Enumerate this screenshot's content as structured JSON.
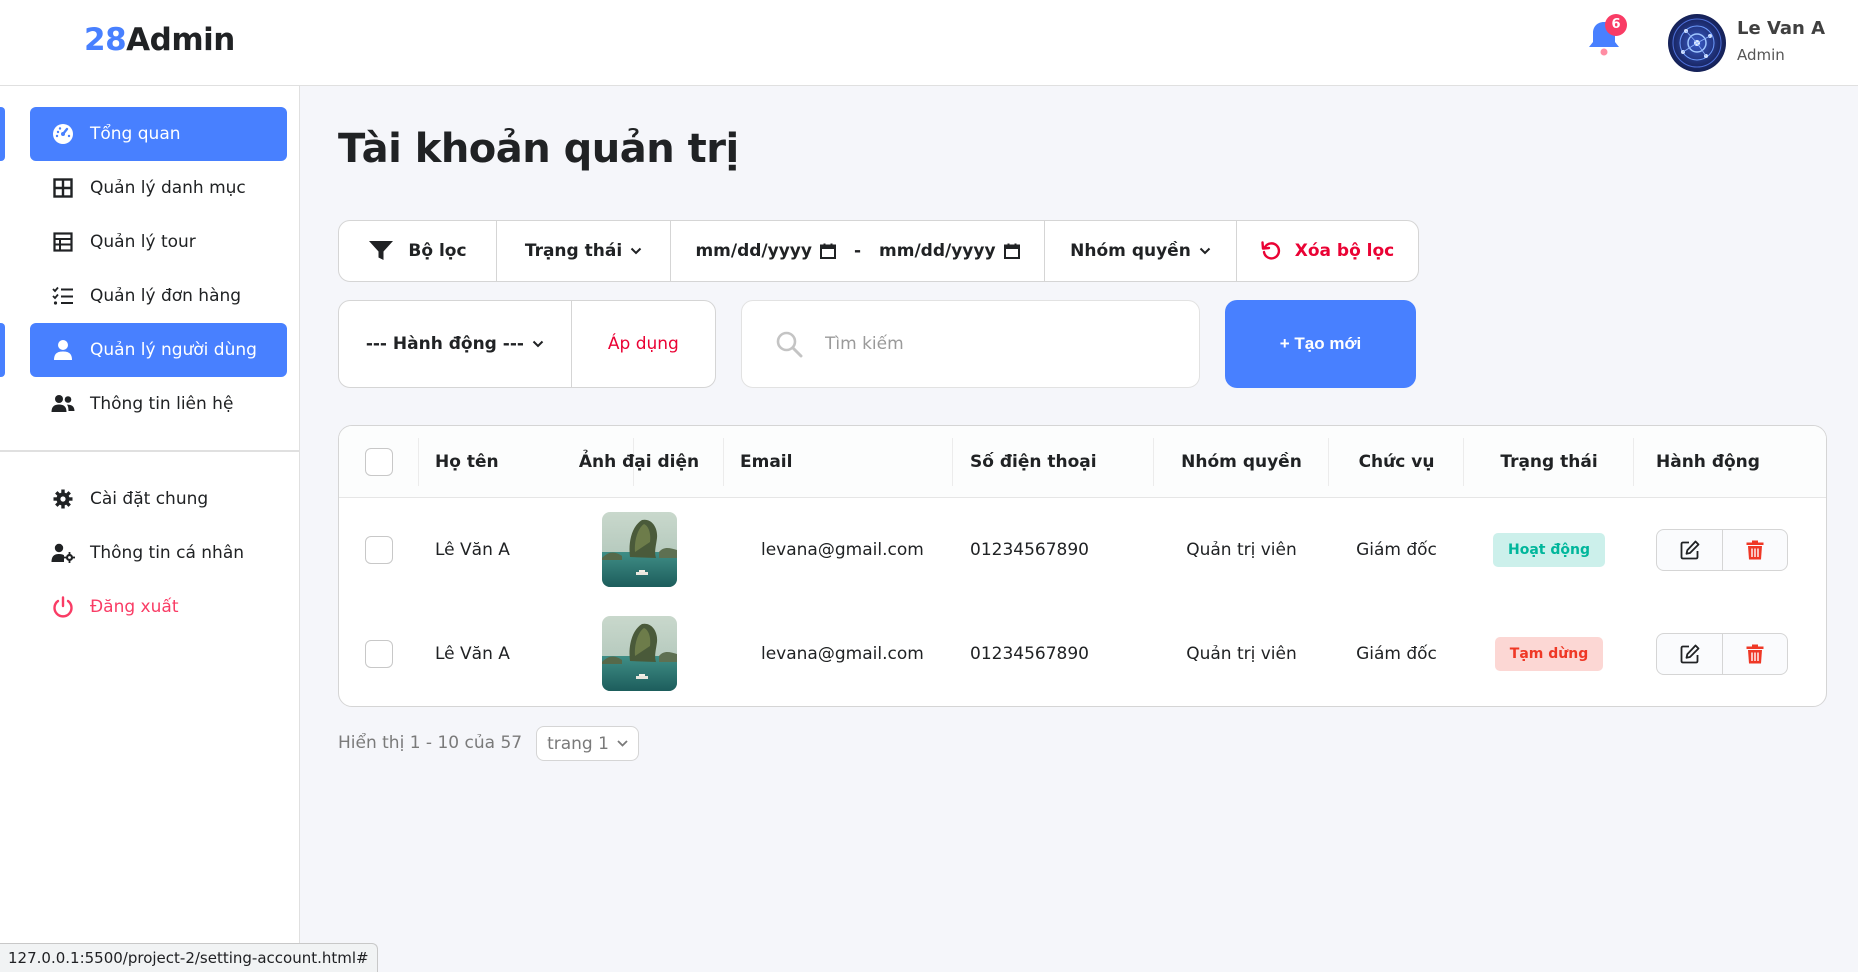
{
  "header": {
    "logo_number": "28",
    "logo_text": "Admin",
    "notification_count": "6",
    "user_name": "Le Van A",
    "user_role": "Admin"
  },
  "sidebar": {
    "items": [
      {
        "label": "Tổng quan",
        "icon": "dashboard-icon",
        "active": true
      },
      {
        "label": "Quản lý danh mục",
        "icon": "grid-icon",
        "active": false
      },
      {
        "label": "Quản lý tour",
        "icon": "table-icon",
        "active": false
      },
      {
        "label": "Quản lý đơn hàng",
        "icon": "checklist-icon",
        "active": false
      },
      {
        "label": "Quản lý người dùng",
        "icon": "user-icon",
        "active": true
      },
      {
        "label": "Thông tin liên hệ",
        "icon": "users-icon",
        "active": false
      }
    ],
    "bottom_items": [
      {
        "label": "Cài đặt chung",
        "icon": "gear-icon"
      },
      {
        "label": "Thông tin cá nhân",
        "icon": "user-gear-icon"
      },
      {
        "label": "Đăng xuất",
        "icon": "power-icon"
      }
    ]
  },
  "main": {
    "title": "Tài khoản quản trị",
    "filter": {
      "label": "Bộ lọc",
      "status": "Trạng thái",
      "date_from": "mm/dd/yyyy",
      "date_sep": "-",
      "date_to": "mm/dd/yyyy",
      "role_group": "Nhóm quyền",
      "reset": "Xóa bộ lọc"
    },
    "bulk_action": "--- Hành động ---",
    "apply": "Áp dụng",
    "search_placeholder": "Tìm kiếm",
    "create": "+ Tạo mới"
  },
  "table": {
    "headers": [
      "Họ tên",
      "Ảnh đại diện",
      "Email",
      "Số điện thoại",
      "Nhóm quyền",
      "Chức vụ",
      "Trạng thái",
      "Hành động"
    ],
    "rows": [
      {
        "name": "Lê Văn A",
        "email": "levana@gmail.com",
        "phone": "01234567890",
        "role_group": "Quản trị viên",
        "position": "Giám đốc",
        "status": "Hoạt động",
        "status_type": "active"
      },
      {
        "name": "Lê Văn A",
        "email": "levana@gmail.com",
        "phone": "01234567890",
        "role_group": "Quản trị viên",
        "position": "Giám đốc",
        "status": "Tạm dừng",
        "status_type": "paused"
      }
    ]
  },
  "pagination": {
    "summary": "Hiển thị 1 - 10 của 57",
    "page_select": "trang 1"
  },
  "browser_status_url": "127.0.0.1:5500/project-2/setting-account.html#",
  "colors": {
    "primary": "#4880ff",
    "danger": "#ea0234",
    "active_badge_bg": "#ccf0eb",
    "active_badge_text": "#00b69b",
    "paused_badge_bg": "#fcd7d4",
    "paused_badge_text": "#ef3826"
  }
}
